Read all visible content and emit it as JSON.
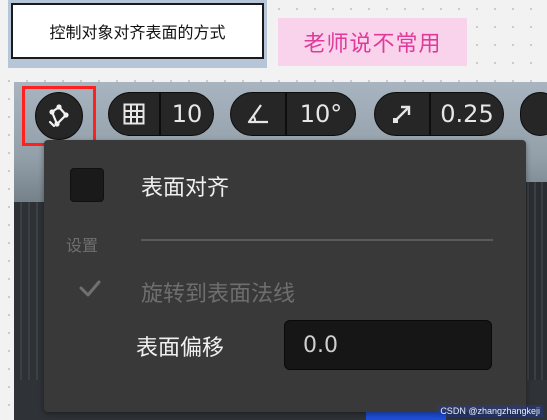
{
  "caption": {
    "text": "控制对象对齐表面的方式"
  },
  "note": {
    "text": "老师说不常用"
  },
  "toolbar": {
    "surface_snap_icon": "surface-snap-icon",
    "grid": {
      "icon": "grid-icon",
      "value": "10"
    },
    "rotation": {
      "icon": "angle-icon",
      "value": "10°"
    },
    "scale": {
      "icon": "scale-arrow-icon",
      "value": "0.25"
    }
  },
  "panel": {
    "surface_align_label": "表面对齐",
    "surface_align_checked": false,
    "settings_label": "设置",
    "rotate_to_normal_label": "旋转到表面法线",
    "offset_label": "表面偏移",
    "offset_value": "0.0"
  },
  "watermark": "CSDN @zhangzhangkeji",
  "colors": {
    "highlight": "#ff2020",
    "note_bg": "#f9d3ec",
    "note_text": "#e03a9a",
    "panel_bg": "#393939",
    "caption_frame": "#b7c5d9"
  }
}
